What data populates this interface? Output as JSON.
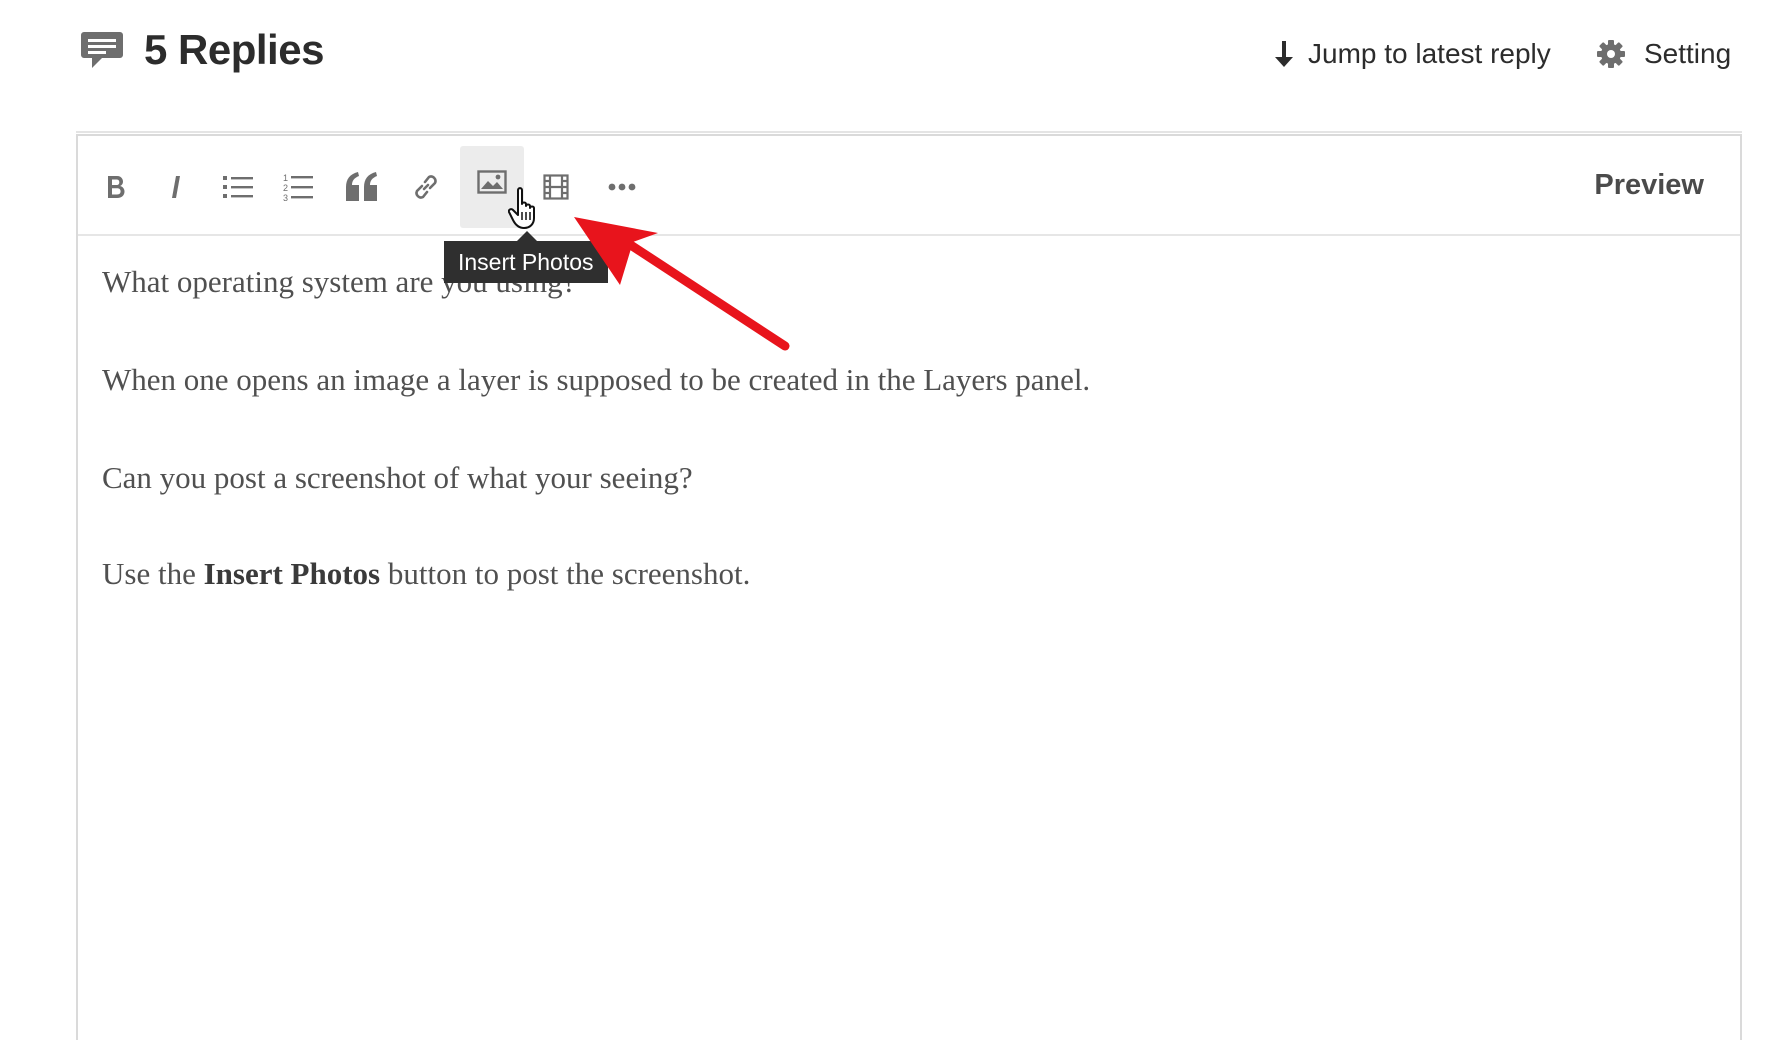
{
  "header": {
    "replies_title": "5 Replies",
    "jump_label": "Jump to latest reply",
    "setting_label": "Setting"
  },
  "toolbar": {
    "buttons": [
      {
        "name": "bold",
        "icon": "bold-icon",
        "label": "B"
      },
      {
        "name": "italic",
        "icon": "italic-icon",
        "label": "I"
      },
      {
        "name": "bulleted-list",
        "icon": "bulleted-list-icon"
      },
      {
        "name": "numbered-list",
        "icon": "numbered-list-icon"
      },
      {
        "name": "quote",
        "icon": "quote-icon"
      },
      {
        "name": "link",
        "icon": "link-icon"
      },
      {
        "name": "insert-photos",
        "icon": "image-icon",
        "active": true
      },
      {
        "name": "insert-video",
        "icon": "film-icon"
      },
      {
        "name": "more",
        "icon": "more-icon"
      }
    ],
    "preview_label": "Preview",
    "tooltip": "Insert Photos"
  },
  "content": {
    "para1": "What operating system are you using?",
    "para2": "When one opens an image a layer is supposed to be created in the Layers panel.",
    "para3": "Can you post a screenshot of what your seeing?",
    "para4_pre": "Use the ",
    "para4_bold": "Insert Photos",
    "para4_post": " button to post the screenshot."
  },
  "colors": {
    "annotation_arrow": "#e8141c",
    "tooltip_bg": "#2f2f2f",
    "icon_gray": "#6e6e6e"
  }
}
